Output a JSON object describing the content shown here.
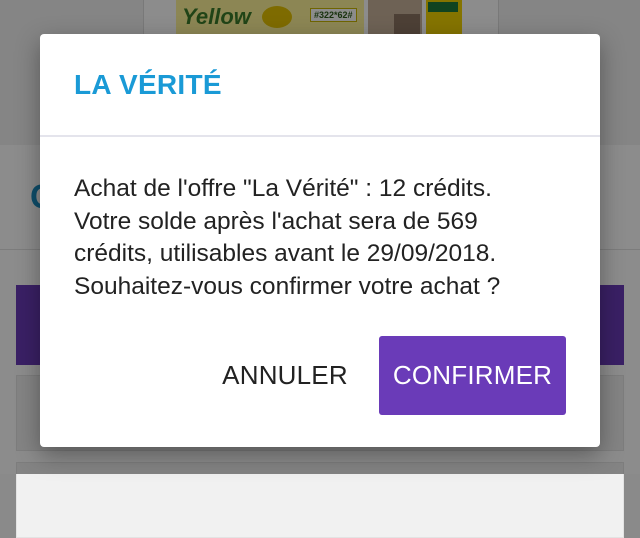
{
  "background": {
    "newspaper_brand": "Yellow",
    "newspaper_code": "#322*62#",
    "section_letter": "C"
  },
  "dialog": {
    "title": "LA VÉRITÉ",
    "message_lines": [
      "Achat de l'offre \"La Vérité\" : 12 crédits.",
      "Votre solde après l'achat sera de 569",
      "crédits, utilisables avant le 29/09/2018.",
      "Souhaitez-vous confirmer votre achat ?"
    ],
    "cancel_label": "ANNULER",
    "confirm_label": "CONFIRMER"
  },
  "colors": {
    "title": "#1a9ad6",
    "primary_button": "#6a3bb8",
    "scrim": "rgba(0,0,0,0.45)"
  }
}
